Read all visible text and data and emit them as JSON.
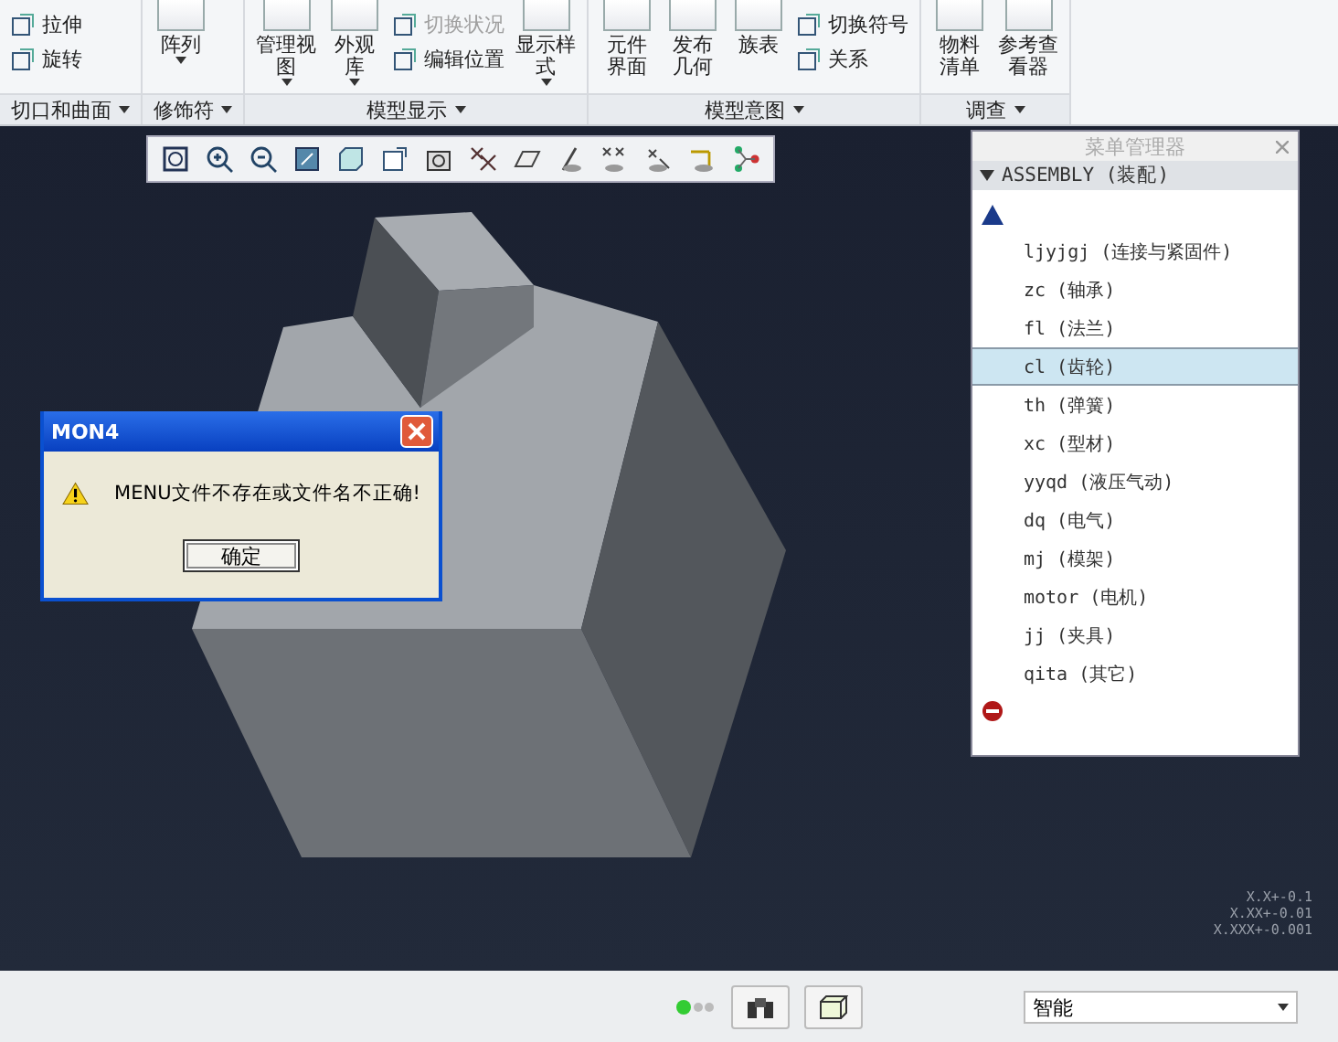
{
  "ribbon": {
    "groups": [
      {
        "label": "切口和曲面",
        "items": [
          {
            "kind": "small",
            "label": "拉伸",
            "disabled": false
          },
          {
            "kind": "small",
            "label": "旋转",
            "disabled": false
          }
        ]
      },
      {
        "label": "修饰符",
        "items": [
          {
            "kind": "large",
            "lines": [
              "阵列"
            ],
            "has_menu": true
          }
        ]
      },
      {
        "label": "模型显示",
        "items": [
          {
            "kind": "large",
            "lines": [
              "管理视",
              "图"
            ],
            "has_menu": true
          },
          {
            "kind": "large",
            "lines": [
              "外观",
              "库"
            ],
            "has_menu": true
          },
          {
            "kind": "small",
            "label": "切换状况",
            "disabled": true
          },
          {
            "kind": "small",
            "label": "编辑位置",
            "disabled": false
          },
          {
            "kind": "large",
            "lines": [
              "显示样",
              "式"
            ],
            "has_menu": true
          }
        ]
      },
      {
        "label": "模型意图",
        "items": [
          {
            "kind": "large",
            "lines": [
              "元件",
              "界面"
            ],
            "has_menu": false
          },
          {
            "kind": "large",
            "lines": [
              "发布",
              "几何"
            ],
            "has_menu": false
          },
          {
            "kind": "large",
            "lines": [
              "族表"
            ],
            "has_menu": false
          },
          {
            "kind": "small",
            "label": "切换符号",
            "disabled": false
          },
          {
            "kind": "small",
            "label": "关系",
            "disabled": false
          }
        ]
      },
      {
        "label": "调查",
        "items": [
          {
            "kind": "large",
            "lines": [
              "物料",
              "清单"
            ],
            "has_menu": false
          },
          {
            "kind": "large",
            "lines": [
              "参考查",
              "看器"
            ],
            "has_menu": false
          }
        ]
      }
    ]
  },
  "dialog": {
    "title": "MON4",
    "message": "MENU文件不存在或文件名不正确!",
    "button": "确定"
  },
  "menu_manager": {
    "title": "菜单管理器",
    "header": "ASSEMBLY (装配)",
    "items": [
      {
        "label": "ljyjgj (连接与紧固件)",
        "selected": false
      },
      {
        "label": "zc (轴承)",
        "selected": false
      },
      {
        "label": "fl (法兰)",
        "selected": false
      },
      {
        "label": "cl (齿轮)",
        "selected": true
      },
      {
        "label": "th (弹簧)",
        "selected": false
      },
      {
        "label": "xc (型材)",
        "selected": false
      },
      {
        "label": "yyqd (液压气动)",
        "selected": false
      },
      {
        "label": "dq (电气)",
        "selected": false
      },
      {
        "label": "mj (模架)",
        "selected": false
      },
      {
        "label": "motor (电机)",
        "selected": false
      },
      {
        "label": "jj (夹具)",
        "selected": false
      },
      {
        "label": "qita (其它)",
        "selected": false
      }
    ]
  },
  "tolerances": [
    "X.X+-0.1",
    "X.XX+-0.01",
    "X.XXX+-0.001"
  ],
  "status_bar": {
    "filter": "智能"
  }
}
